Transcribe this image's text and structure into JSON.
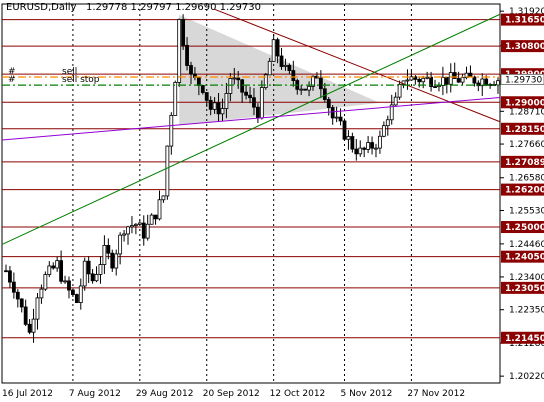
{
  "window": {
    "symbol": "EURUSD",
    "timeframe": "Daily",
    "ohlc": [
      "1.29778",
      "1.29797",
      "1.29690",
      "1.29730"
    ]
  },
  "colors": {
    "background": "#ffffff",
    "grid": "#000000",
    "level_lines": "#8b0000",
    "label_fill": "#8b0000",
    "label_text": "#ffffff",
    "candle_outline": "#000000",
    "bull_body": "#ffffff",
    "bear_body": "#000000",
    "trendline_down": "#8b0000",
    "trendline_green": "#008000",
    "trendline_purple": "#9400d3",
    "triangle_fill": "#c8c8c8",
    "sell_line": "#ff8c00",
    "sell_stop_line": "#008000",
    "price_marker": "#808080"
  },
  "orders": [
    {
      "mark": "#",
      "label": "sell",
      "price": 1.2981,
      "style": "dash-dot",
      "color_key": "sell_line"
    },
    {
      "mark": "#",
      "label": "sell stop",
      "price": 1.2955,
      "style": "dash-dot",
      "color_key": "sell_stop_line"
    }
  ],
  "chart_data": {
    "type": "candlestick",
    "ylim": [
      1.2,
      1.3215
    ],
    "y_ticks": [
      "1.31920",
      "1.30810",
      "1.29730",
      "1.28710",
      "1.27660",
      "1.26580",
      "1.25530",
      "1.24460",
      "1.23400",
      "1.22350",
      "1.21280",
      "1.20220"
    ],
    "horizontal_levels": [
      "1.31650",
      "1.30800",
      "1.29900",
      "1.29000",
      "1.28150",
      "1.27089",
      "1.26200",
      "1.25000",
      "1.24050",
      "1.23050",
      "1.21450"
    ],
    "current_price": "1.29730",
    "x_labels": [
      "16 Jul 2012",
      "7 Aug 2012",
      "29 Aug 2012",
      "20 Sep 2012",
      "12 Oct 2012",
      "5 Nov 2012",
      "27 Nov 2012"
    ],
    "bar_count": 126,
    "trendlines": [
      {
        "name": "falling resistance",
        "color_key": "trendline_down",
        "from": [
          53,
          1.3198
        ],
        "to": [
          126,
          1.2835
        ]
      },
      {
        "name": "rising support",
        "color_key": "trendline_green",
        "from": [
          0,
          1.245
        ],
        "to": [
          126,
          1.3185
        ]
      },
      {
        "name": "wedge base",
        "color_key": "trendline_purple",
        "from": [
          0,
          1.278
        ],
        "to": [
          116,
          1.2905
        ]
      }
    ],
    "triangle": {
      "top_bar": 44,
      "right_bar": 95,
      "top_price": 1.318,
      "base_price": 1.2826,
      "right_price": 1.2898
    },
    "control_points": [
      [
        0,
        1.236
      ],
      [
        2,
        1.231
      ],
      [
        5,
        1.22
      ],
      [
        6,
        1.216
      ],
      [
        8,
        1.229
      ],
      [
        10,
        1.234
      ],
      [
        13,
        1.238
      ],
      [
        15,
        1.231
      ],
      [
        18,
        1.226
      ],
      [
        20,
        1.237
      ],
      [
        22,
        1.233
      ],
      [
        25,
        1.242
      ],
      [
        27,
        1.239
      ],
      [
        30,
        1.25
      ],
      [
        33,
        1.251
      ],
      [
        35,
        1.248
      ],
      [
        38,
        1.2545
      ],
      [
        40,
        1.26
      ],
      [
        41,
        1.276
      ],
      [
        43,
        1.298
      ],
      [
        44,
        1.316
      ],
      [
        45,
        1.31
      ],
      [
        47,
        1.298
      ],
      [
        50,
        1.295
      ],
      [
        52,
        1.288
      ],
      [
        55,
        1.288
      ],
      [
        57,
        1.298
      ],
      [
        59,
        1.295
      ],
      [
        61,
        1.292
      ],
      [
        64,
        1.287
      ],
      [
        66,
        1.298
      ],
      [
        68,
        1.308
      ],
      [
        71,
        1.3
      ],
      [
        74,
        1.296
      ],
      [
        77,
        1.294
      ],
      [
        79,
        1.299
      ],
      [
        81,
        1.293
      ],
      [
        83,
        1.285
      ],
      [
        85,
        1.282
      ],
      [
        88,
        1.276
      ],
      [
        90,
        1.274
      ],
      [
        92,
        1.275
      ],
      [
        95,
        1.278
      ],
      [
        97,
        1.286
      ],
      [
        99,
        1.29
      ],
      [
        101,
        1.298
      ],
      [
        104,
        1.2975
      ],
      [
        107,
        1.2973
      ],
      [
        110,
        1.2972
      ],
      [
        113,
        1.2973
      ],
      [
        116,
        1.2973
      ],
      [
        126,
        1.2973
      ]
    ]
  }
}
